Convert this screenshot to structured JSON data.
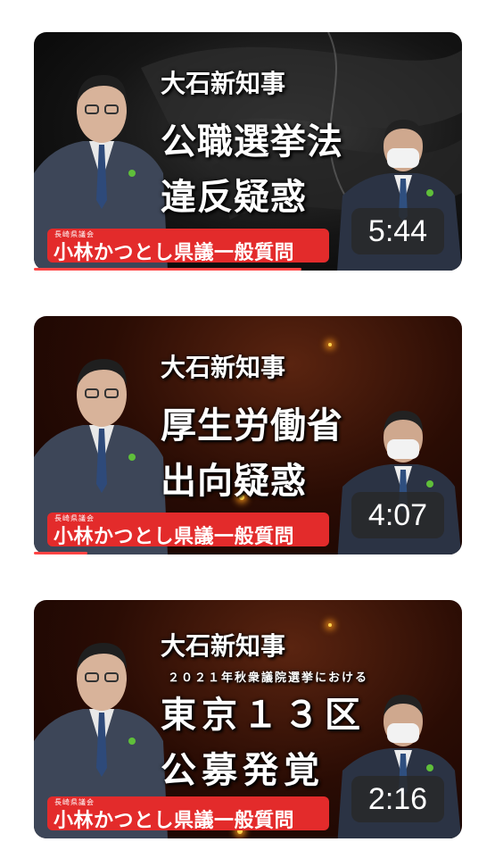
{
  "videos": [
    {
      "title_small": "大石新知事",
      "subtitle": "",
      "title_line1": "公職選挙法",
      "title_line2": "違反疑惑",
      "banner_small": "長崎県議会",
      "banner_main": "小林かつとし県議一般質問",
      "duration": "5:44",
      "theme": "dark"
    },
    {
      "title_small": "大石新知事",
      "subtitle": "",
      "title_line1": "厚生労働省",
      "title_line2": "出向疑惑",
      "banner_small": "長崎県議会",
      "banner_main": "小林かつとし県議一般質問",
      "duration": "4:07",
      "theme": "ember"
    },
    {
      "title_small": "大石新知事",
      "subtitle": "２０２１年秋衆議院選挙における",
      "title_line1": "東京１３区",
      "title_line2": "公募発覚",
      "banner_small": "長崎県議会",
      "banner_main": "小林かつとし県議一般質問",
      "duration": "2:16",
      "theme": "ember"
    }
  ],
  "colors": {
    "banner": "#e32b2b",
    "progress": "#ff4444",
    "duration_bg": "#282828"
  }
}
